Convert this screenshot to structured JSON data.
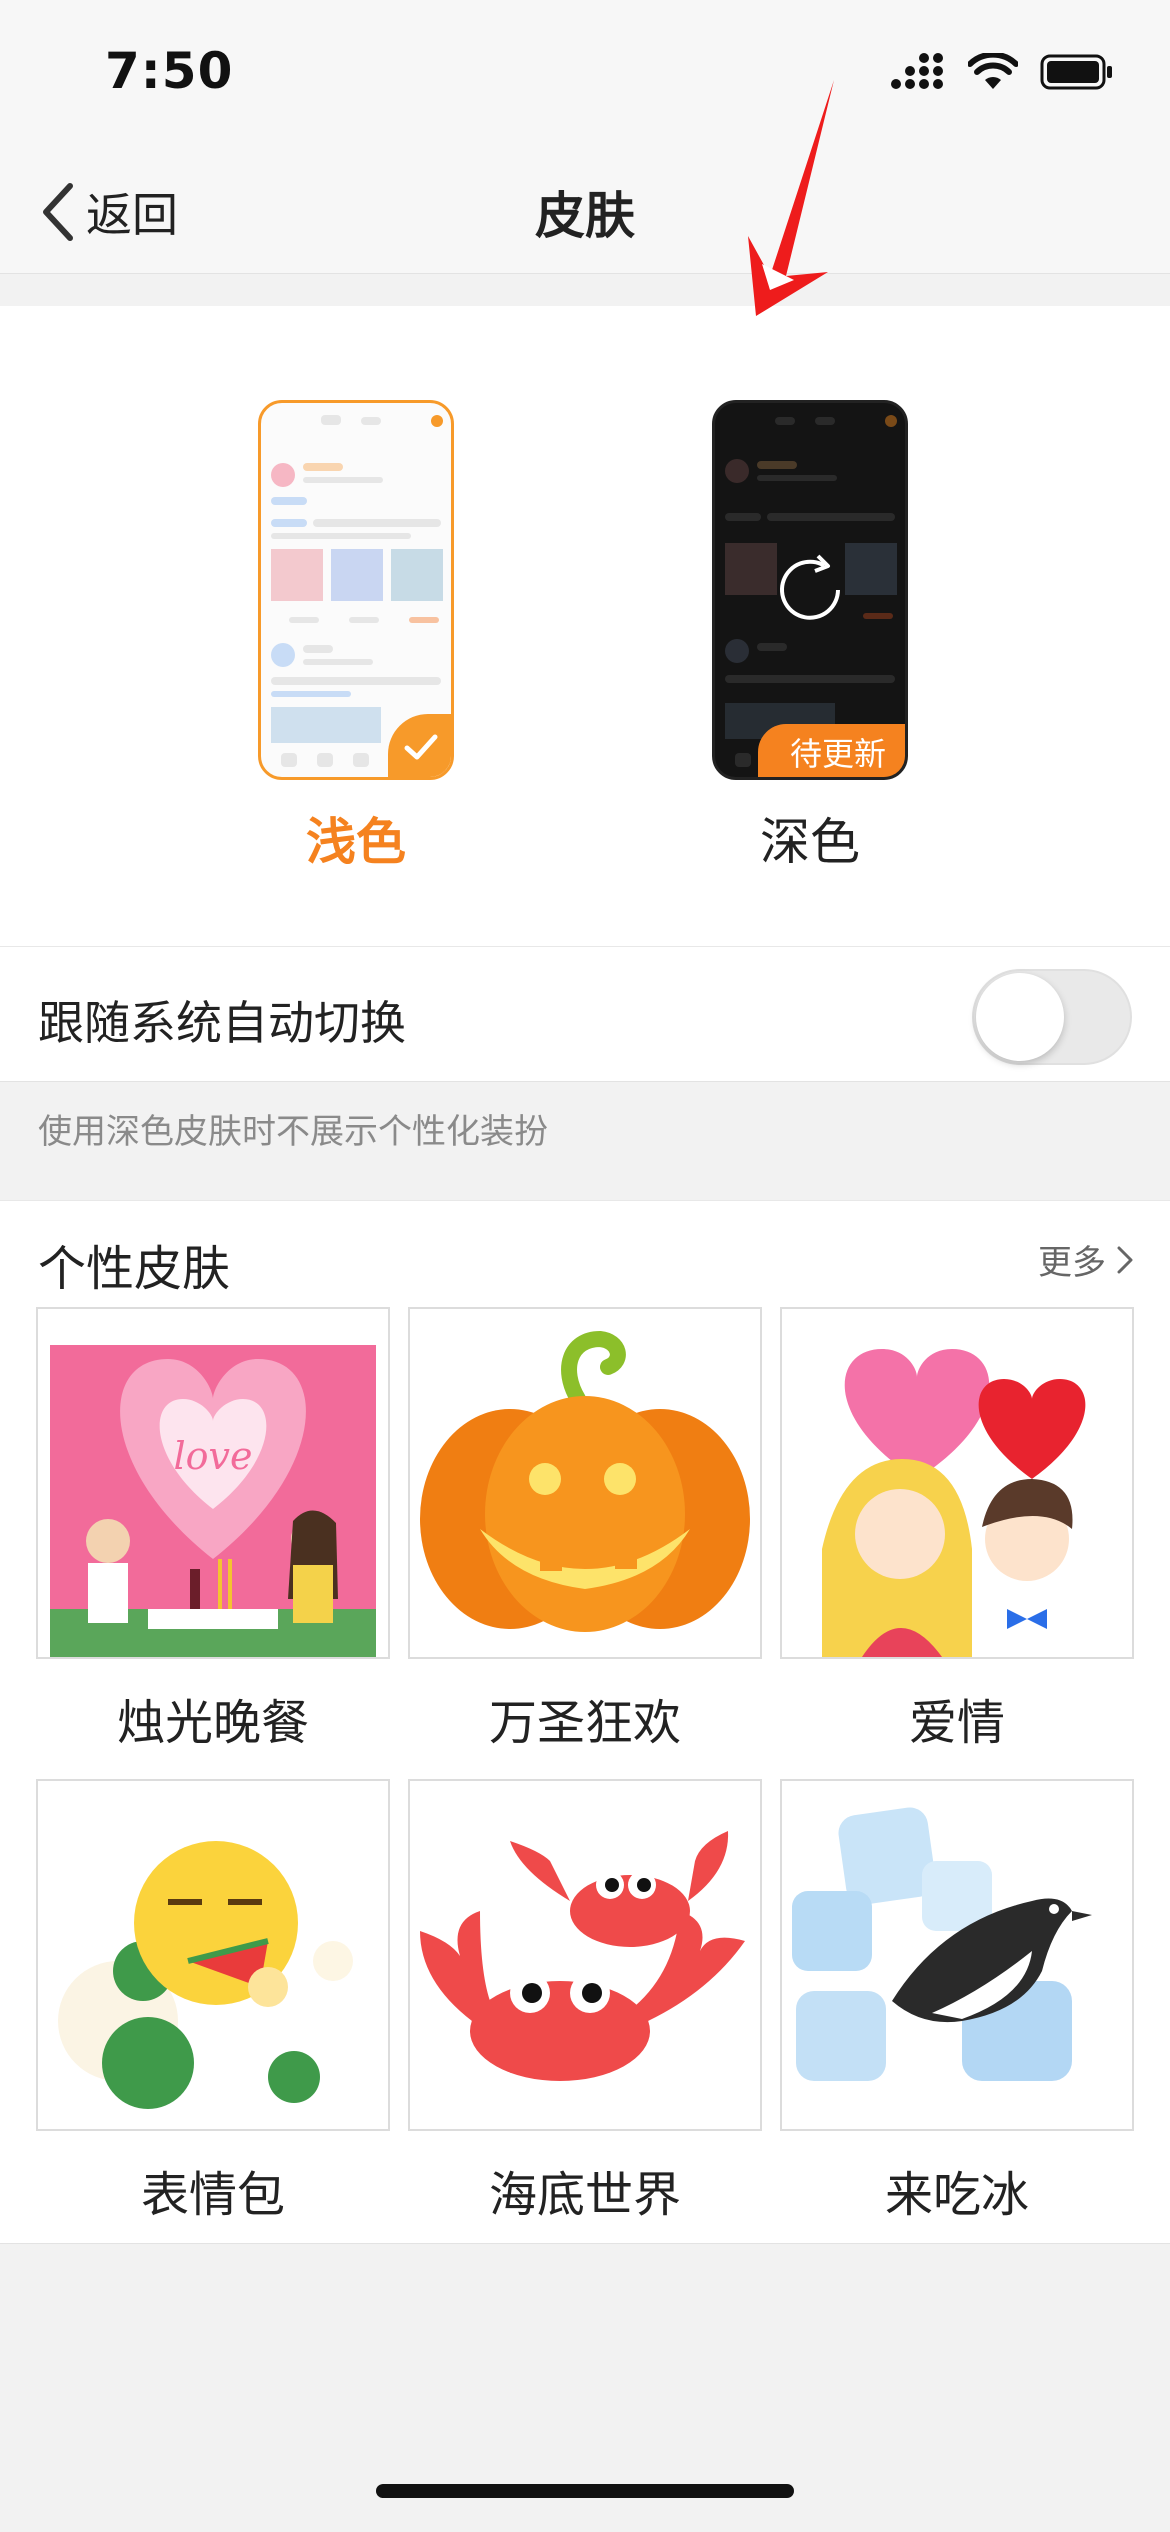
{
  "status_bar": {
    "time": "7:50"
  },
  "nav": {
    "back_label": "返回",
    "title": "皮肤"
  },
  "theme": {
    "options": [
      {
        "label": "浅色",
        "selected": true
      },
      {
        "label": "深色",
        "selected": false,
        "badge": "待更新"
      }
    ]
  },
  "auto_switch": {
    "label": "跟随系统自动切换",
    "enabled": false
  },
  "hint": "使用深色皮肤时不展示个性化装扮",
  "skins": {
    "title": "个性皮肤",
    "more_label": "更多",
    "items": [
      {
        "label": "烛光晚餐"
      },
      {
        "label": "万圣狂欢"
      },
      {
        "label": "爱情"
      },
      {
        "label": "表情包"
      },
      {
        "label": "海底世界"
      },
      {
        "label": "来吃冰"
      }
    ]
  },
  "colors": {
    "accent": "#f5821f",
    "background": "#f2f2f2"
  }
}
